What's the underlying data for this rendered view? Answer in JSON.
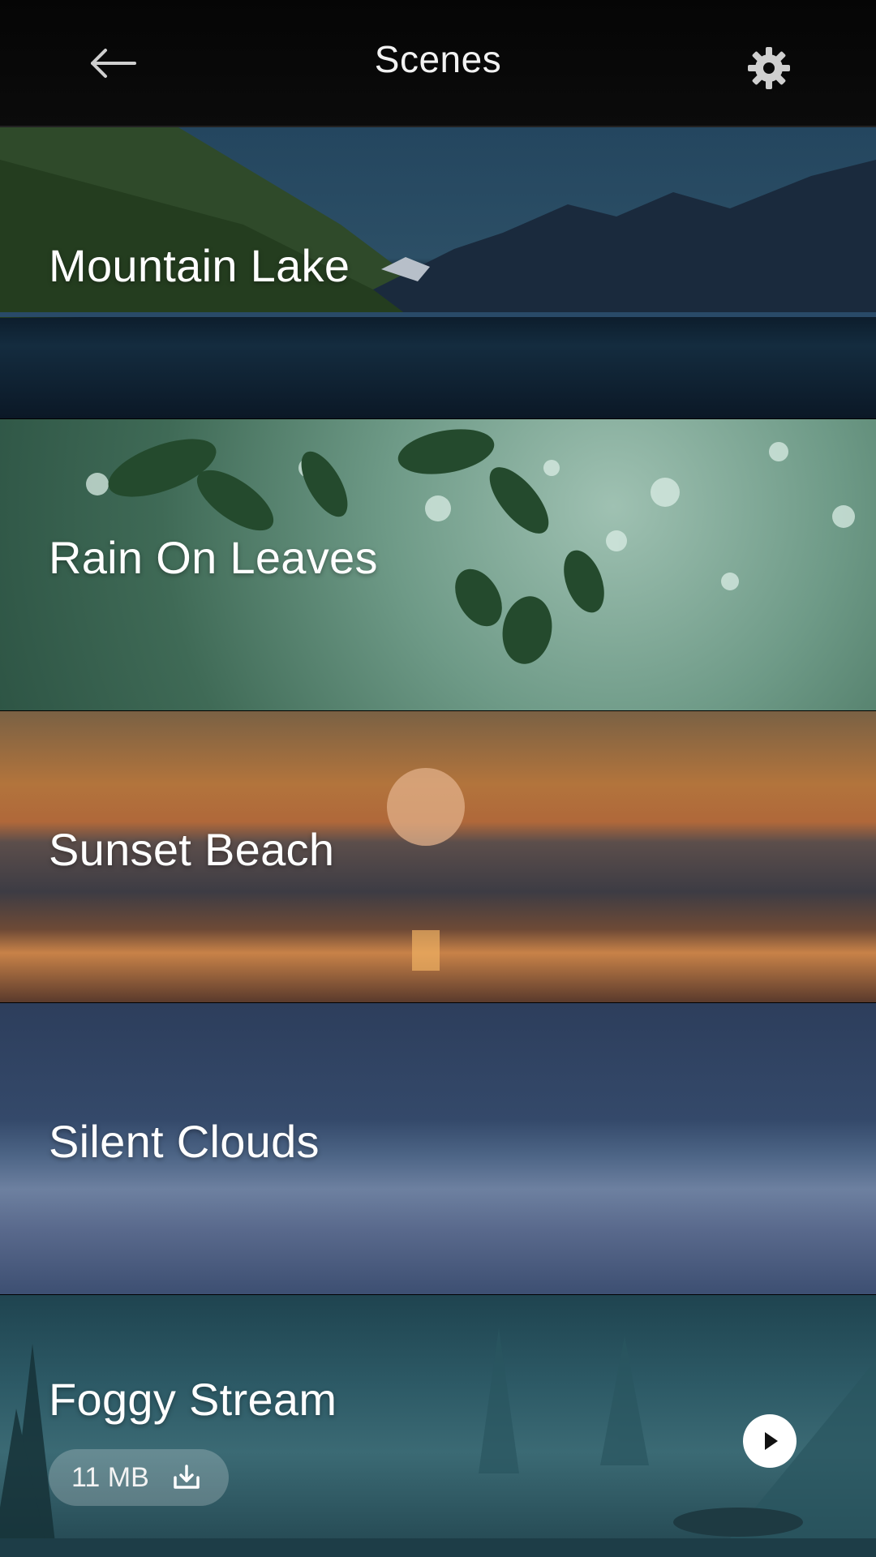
{
  "header": {
    "title": "Scenes",
    "back_icon": "arrow-left-icon",
    "settings_icon": "gear-icon"
  },
  "scenes": [
    {
      "label": "Mountain Lake"
    },
    {
      "label": "Rain On Leaves"
    },
    {
      "label": "Sunset Beach"
    },
    {
      "label": "Silent Clouds"
    },
    {
      "label": "Foggy Stream",
      "size": "11 MB",
      "download_icon": "download-icon",
      "play_icon": "play-icon"
    }
  ],
  "colors": {
    "header_bg": "#080808",
    "badge_bg": "rgba(255,255,255,0.22)"
  }
}
